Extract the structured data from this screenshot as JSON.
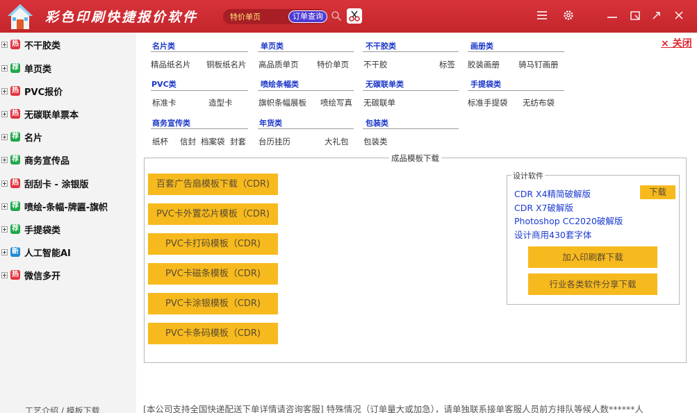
{
  "colors": {
    "title_bar": "#c3262c",
    "accent_button": "#f7ba1e",
    "link_blue": "#1a36c8",
    "close_red": "#e0262d"
  },
  "app": {
    "title": "彩色印刷快捷报价软件"
  },
  "search": {
    "text": "特价单页",
    "order_query": "订单查询"
  },
  "window_controls": [
    "menu-icon",
    "gear-icon",
    "minimize-icon",
    "restore-icon",
    "expand-icon",
    "close-icon"
  ],
  "sidebar": {
    "items": [
      {
        "label": "不干胶类",
        "badge": "热"
      },
      {
        "label": "单页类",
        "badge": "荐"
      },
      {
        "label": "PVC报价",
        "badge": "热"
      },
      {
        "label": "无碳联单票本",
        "badge": "热"
      },
      {
        "label": "名片",
        "badge": "荐"
      },
      {
        "label": "商务宣传品",
        "badge": "荐"
      },
      {
        "label": "刮刮卡 - 涂银版",
        "badge": "热"
      },
      {
        "label": "喷绘-条幅-牌匾-旗帜",
        "badge": "荐"
      },
      {
        "label": "手提袋类",
        "badge": "荐"
      },
      {
        "label": "人工智能AI",
        "badge": "新"
      },
      {
        "label": "微信多开",
        "badge": "热"
      }
    ],
    "footer": "工艺介绍 / 模板下载"
  },
  "categories": [
    {
      "head": "名片类",
      "links": [
        "精品纸名片",
        "铜板纸名片"
      ]
    },
    {
      "head": "单页类",
      "links": [
        "高品质单页",
        "特价单页"
      ]
    },
    {
      "head": "不干胶类",
      "links": [
        "不干胶",
        "标签"
      ]
    },
    {
      "head": "画册类",
      "links": [
        "胶装画册",
        "骑马钉画册"
      ]
    },
    {
      "head": "PVC类",
      "links": [
        "标准卡",
        "造型卡"
      ]
    },
    {
      "head": "喷绘条幅类",
      "links": [
        "旗帜条幅展板",
        "喷绘写真"
      ]
    },
    {
      "head": "无碳联单类",
      "links": [
        "无碳联单"
      ]
    },
    {
      "head": "手提袋类",
      "links": [
        "标准手提袋",
        "无纺布袋"
      ]
    },
    {
      "head": "商务宣传类",
      "links": [
        "纸杯",
        "信封",
        "档案袋",
        "封套"
      ]
    },
    {
      "head": "年货类",
      "links": [
        "台历挂历",
        "大礼包"
      ]
    },
    {
      "head": "包装类",
      "links": [
        "包装类"
      ]
    }
  ],
  "close_link": "× 关闭",
  "templates": {
    "legend": "成品模板下载",
    "buttons": [
      "百套广告扇模板下载（CDR)",
      "PVC卡外置芯片模板（CDR)",
      "PVC卡打码模板（CDR)",
      "PVC卡磁条模板（CDR)",
      "PVC卡涂银模板（CDR)",
      "PVC卡条码模板（CDR)"
    ]
  },
  "software": {
    "legend": "设计软件",
    "lines": [
      "CDR X4精简破解版",
      "CDR X7破解版",
      "Photoshop CC2020破解版",
      "设计商用430套字体"
    ],
    "download": "下载",
    "buttons": [
      "加入印刷群下载",
      "行业各类软件分享下载"
    ]
  },
  "notice": "[本公司支持全国快递配送下单详情请咨询客服] 特殊情况（订单量大或加急），请单独联系接单客服人员前方排队等候人数******人"
}
